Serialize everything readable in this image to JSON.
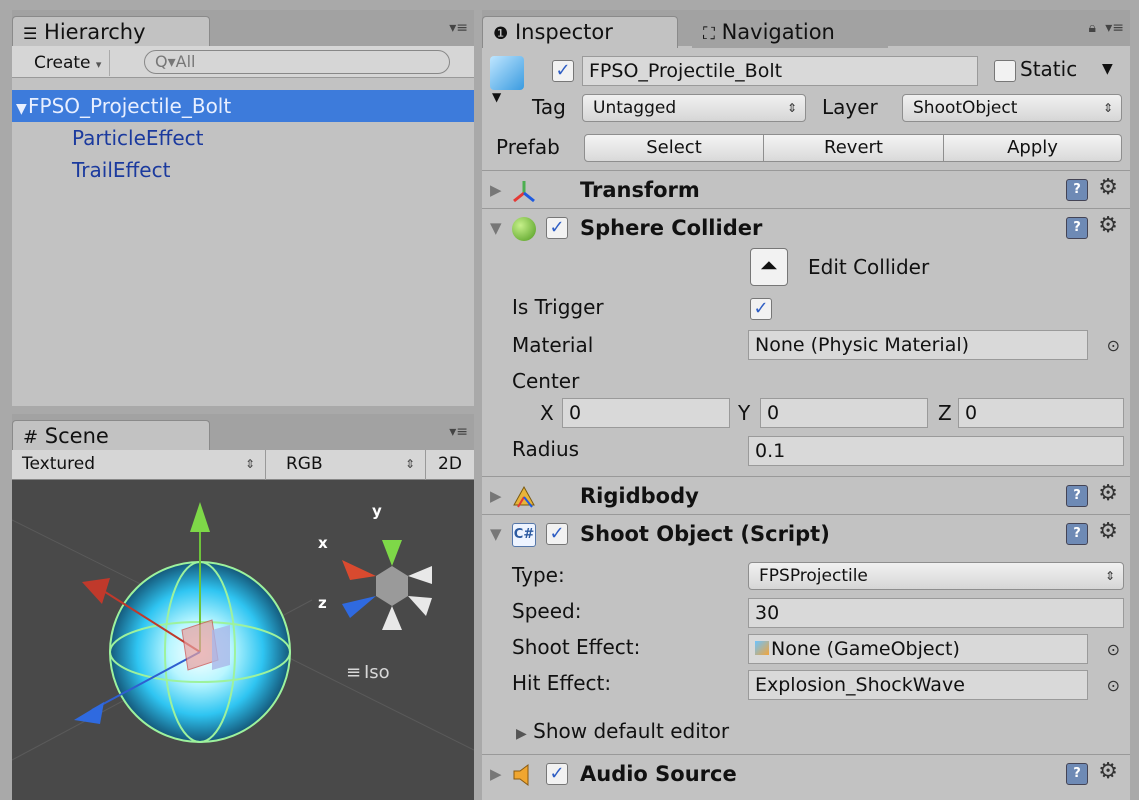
{
  "hierarchy": {
    "tab_title": "Hierarchy",
    "create_label": "Create",
    "search_placeholder": "Q▾All",
    "items": [
      {
        "label": "FPSO_Projectile_Bolt"
      },
      {
        "label": "ParticleEffect"
      },
      {
        "label": "TrailEffect"
      }
    ]
  },
  "scene": {
    "tab_title": "Scene",
    "draw_mode": "Textured",
    "render_mode": "RGB",
    "view_2d": "2D",
    "gizmo": {
      "x": "x",
      "y": "y",
      "z": "z",
      "projection": "Iso"
    }
  },
  "inspector": {
    "tab_title": "Inspector",
    "nav_tab_title": "Navigation",
    "object_name": "FPSO_Projectile_Bolt",
    "static_label": "Static",
    "tag_label": "Tag",
    "tag_value": "Untagged",
    "layer_label": "Layer",
    "layer_value": "ShootObject",
    "prefab_label": "Prefab",
    "prefab_select": "Select",
    "prefab_revert": "Revert",
    "prefab_apply": "Apply",
    "components": {
      "transform": "Transform",
      "sphere_collider": {
        "title": "Sphere Collider",
        "edit_collider": "Edit Collider",
        "is_trigger_label": "Is Trigger",
        "material_label": "Material",
        "material_value": "None (Physic Material)",
        "center_label": "Center",
        "cx_label": "X",
        "cx": "0",
        "cy_label": "Y",
        "cy": "0",
        "cz_label": "Z",
        "cz": "0",
        "radius_label": "Radius",
        "radius": "0.1"
      },
      "rigidbody": "Rigidbody",
      "shoot_object": {
        "title": "Shoot Object (Script)",
        "type_label": "Type:",
        "type_value": "FPSProjectile",
        "speed_label": "Speed:",
        "speed_value": "30",
        "shoot_effect_label": "Shoot Effect:",
        "shoot_effect_value": "None (GameObject)",
        "hit_effect_label": "Hit Effect:",
        "hit_effect_value": "Explosion_ShockWave",
        "show_default": "Show default editor"
      },
      "audio_source": "Audio Source"
    }
  },
  "colors": {
    "selection": "#3d7bdb",
    "tree_text": "#1b3a9e",
    "viewport": "#494949"
  }
}
